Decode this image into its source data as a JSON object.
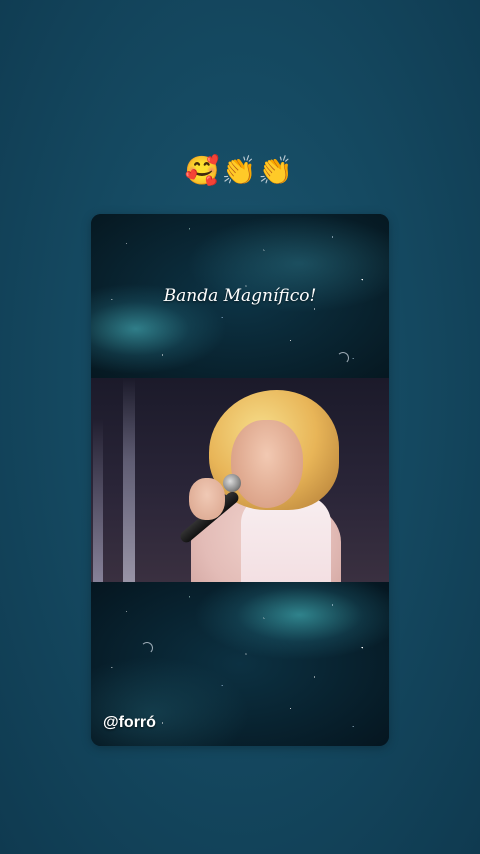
{
  "story": {
    "emoji_caption": "🥰👏👏",
    "card": {
      "title": "Banda Magnífico!",
      "handle": "@forró"
    }
  }
}
